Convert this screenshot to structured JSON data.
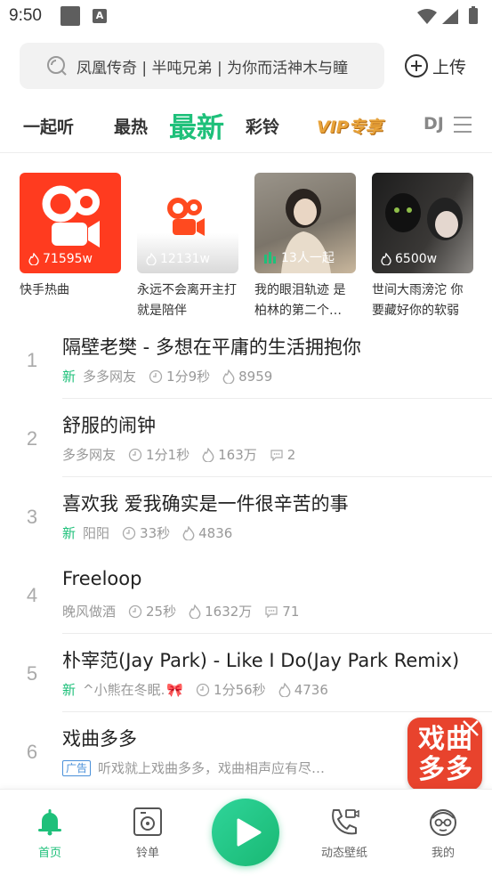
{
  "status_bar": {
    "time": "9:50",
    "a_icon": "A"
  },
  "search": {
    "placeholder": "凤凰传奇 | 半吨兄弟 | 为你而活神木与瞳"
  },
  "upload": {
    "label": "上传"
  },
  "tabs": [
    {
      "label": "一起听"
    },
    {
      "label": "最热"
    },
    {
      "label": "最新",
      "active": true
    },
    {
      "label": "彩铃"
    },
    {
      "label": "VIP专享"
    },
    {
      "label": "DJ"
    }
  ],
  "cards": [
    {
      "title": "快手热曲",
      "count": "71595w",
      "bg": "#ff3b1f"
    },
    {
      "title": "永远不会离开主打就是陪伴",
      "count": "12131w",
      "bg": "#ffffff"
    },
    {
      "title": "我的眼泪轨迹 是柏林的第二个…",
      "count": "13人一起",
      "bg": "#8b8479"
    },
    {
      "title": "世间大雨滂沱 你要藏好你的软弱",
      "count": "6500w",
      "bg": "#2b2a2a"
    }
  ],
  "songs": [
    {
      "index": "1",
      "title": "隔壁老樊 - 多想在平庸的生活拥抱你",
      "new": "新",
      "author": "多多网友",
      "duration": "1分9秒",
      "plays": "8959",
      "comments": ""
    },
    {
      "index": "2",
      "title": "舒服的闹钟",
      "new": "",
      "author": "多多网友",
      "duration": "1分1秒",
      "plays": "163万",
      "comments": "2"
    },
    {
      "index": "3",
      "title": "喜欢我 爱我确实是一件很辛苦的事",
      "new": "新",
      "author": "阳阳",
      "duration": "33秒",
      "plays": "4836",
      "comments": ""
    },
    {
      "index": "4",
      "title": "Freeloop",
      "new": "",
      "author": "晚风做酒",
      "duration": "25秒",
      "plays": "1632万",
      "comments": "71"
    },
    {
      "index": "5",
      "title": "朴宰范(Jay Park) - Like I Do(Jay Park Remix)",
      "new": "新",
      "author": "^小熊在冬眠.",
      "duration": "1分56秒",
      "plays": "4736",
      "comments": ""
    },
    {
      "index": "6",
      "title": "戏曲多多",
      "ad": "广告",
      "desc": "听戏就上戏曲多多，戏曲相声应有尽…"
    }
  ],
  "float_ad": {
    "text": "戏曲多多"
  },
  "bottom_nav": [
    {
      "label": "首页",
      "icon": "bell-icon",
      "active": true
    },
    {
      "label": "铃单",
      "icon": "playlist-icon"
    },
    {
      "label": "",
      "icon": "play-icon"
    },
    {
      "label": "动态壁纸",
      "icon": "phone-icon"
    },
    {
      "label": "我的",
      "icon": "profile-icon"
    }
  ],
  "colors": {
    "accent": "#1ec07a",
    "vip": "#e8a33a",
    "ad_red": "#e8432d"
  }
}
